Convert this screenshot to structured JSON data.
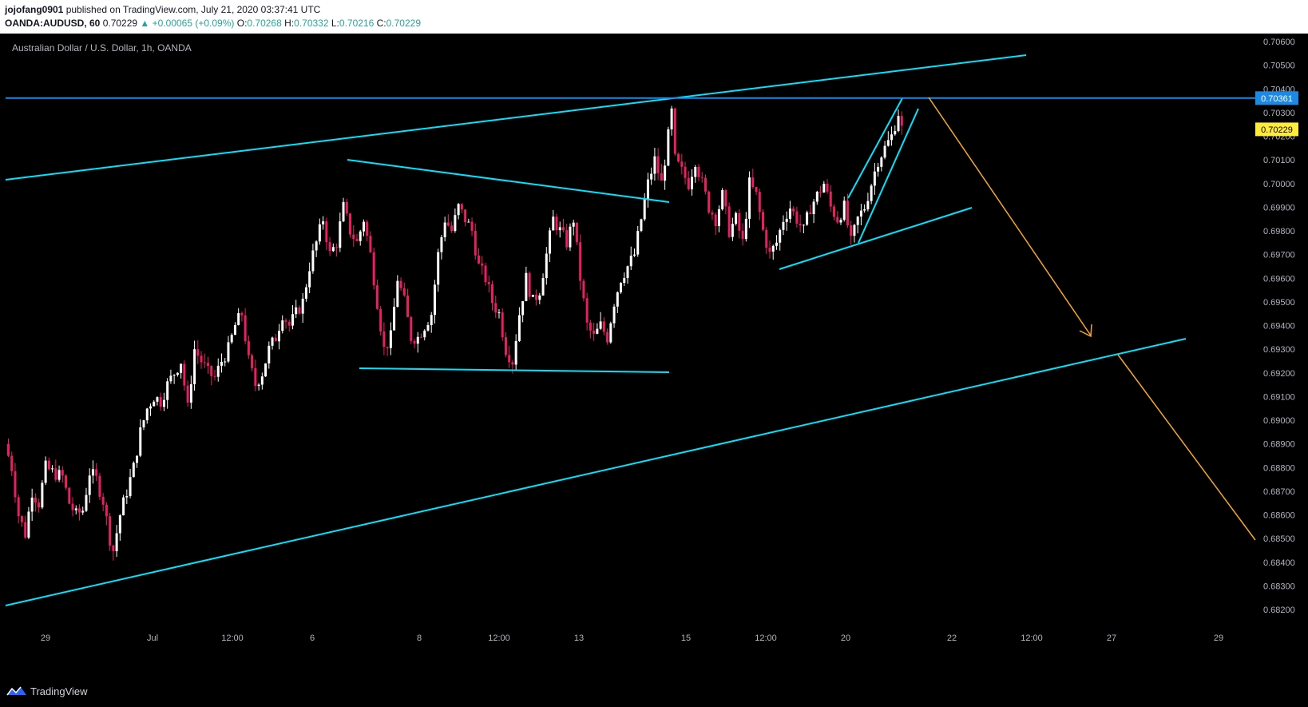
{
  "header": {
    "author": "jojofang0901",
    "published_text": "published on TradingView.com, July 21, 2020 03:37:41 UTC",
    "symbol": "OANDA:AUDUSD, 60",
    "last_price": "0.70229",
    "change": "▲ +0.00065 (+0.09%)",
    "o_label": "O:",
    "o_value": "0.70268",
    "h_label": "H:",
    "h_value": "0.70332",
    "l_label": "L:",
    "l_value": "0.70216",
    "c_label": "C:",
    "c_value": "0.70229"
  },
  "chart_title": "Australian Dollar / U.S. Dollar, 1h, OANDA",
  "footer": {
    "brand": "TradingView"
  },
  "colors": {
    "background": "#000000",
    "up_candle": "#ffffff",
    "down_candle": "#e91e63",
    "trendline": "#00e5ff",
    "hline": "#1e88e5",
    "projection": "#f9a825",
    "axis_text": "#b2b5be"
  },
  "price_labels": {
    "hline": "0.70361",
    "current": "0.70229"
  },
  "chart_data": {
    "type": "candlestick",
    "title": "Australian Dollar / U.S. Dollar, 1h, OANDA",
    "y_ticks": [
      "0.70600",
      "0.70500",
      "0.70400",
      "0.70300",
      "0.70200",
      "0.70100",
      "0.70000",
      "0.69900",
      "0.69800",
      "0.69700",
      "0.69600",
      "0.69500",
      "0.69400",
      "0.69300",
      "0.69200",
      "0.69100",
      "0.69000",
      "0.68900",
      "0.68800",
      "0.68700",
      "0.68600",
      "0.68500",
      "0.68400",
      "0.68300",
      "0.68200"
    ],
    "x_ticks": [
      "29",
      "Jul",
      "12:00",
      "6",
      "8",
      "12:00",
      "13",
      "15",
      "12:00",
      "20",
      "22",
      "12:00",
      "27",
      "29"
    ],
    "ylim": [
      0.6817,
      0.7065
    ],
    "hline_value": 0.70361,
    "current_value": 0.70229,
    "price_path": [
      [
        0,
        0.689
      ],
      [
        2,
        0.688
      ],
      [
        4,
        0.686
      ],
      [
        6,
        0.6852
      ],
      [
        8,
        0.687
      ],
      [
        10,
        0.6865
      ],
      [
        12,
        0.688
      ],
      [
        14,
        0.6878
      ],
      [
        17,
        0.6876
      ],
      [
        19,
        0.6865
      ],
      [
        21,
        0.686
      ],
      [
        23,
        0.6862
      ],
      [
        25,
        0.6878
      ],
      [
        27,
        0.6875
      ],
      [
        29,
        0.6866
      ],
      [
        31,
        0.685
      ],
      [
        32,
        0.6845
      ],
      [
        34,
        0.686
      ],
      [
        36,
        0.687
      ],
      [
        38,
        0.688
      ],
      [
        40,
        0.6895
      ],
      [
        42,
        0.6905
      ],
      [
        44,
        0.691
      ],
      [
        46,
        0.6908
      ],
      [
        48,
        0.6915
      ],
      [
        50,
        0.692
      ],
      [
        52,
        0.6925
      ],
      [
        54,
        0.6905
      ],
      [
        56,
        0.693
      ],
      [
        58,
        0.6925
      ],
      [
        60,
        0.692
      ],
      [
        62,
        0.6918
      ],
      [
        64,
        0.6925
      ],
      [
        66,
        0.693
      ],
      [
        68,
        0.694
      ],
      [
        70,
        0.6945
      ],
      [
        72,
        0.6925
      ],
      [
        74,
        0.6915
      ],
      [
        76,
        0.692
      ],
      [
        78,
        0.693
      ],
      [
        80,
        0.6935
      ],
      [
        82,
        0.6945
      ],
      [
        84,
        0.694
      ],
      [
        86,
        0.6945
      ],
      [
        88,
        0.695
      ],
      [
        90,
        0.6965
      ],
      [
        92,
        0.6975
      ],
      [
        94,
        0.6985
      ],
      [
        96,
        0.697
      ],
      [
        98,
        0.6975
      ],
      [
        100,
        0.699
      ],
      [
        102,
        0.698
      ],
      [
        104,
        0.6975
      ],
      [
        106,
        0.6985
      ],
      [
        108,
        0.697
      ],
      [
        110,
        0.695
      ],
      [
        112,
        0.693
      ],
      [
        114,
        0.6935
      ],
      [
        116,
        0.696
      ],
      [
        118,
        0.695
      ],
      [
        120,
        0.6935
      ],
      [
        122,
        0.6935
      ],
      [
        124,
        0.694
      ],
      [
        126,
        0.6945
      ],
      [
        128,
        0.697
      ],
      [
        130,
        0.6985
      ],
      [
        132,
        0.698
      ],
      [
        134,
        0.699
      ],
      [
        136,
        0.6985
      ],
      [
        138,
        0.698
      ],
      [
        140,
        0.6965
      ],
      [
        142,
        0.696
      ],
      [
        144,
        0.695
      ],
      [
        146,
        0.6945
      ],
      [
        148,
        0.693
      ],
      [
        150,
        0.6925
      ],
      [
        152,
        0.6945
      ],
      [
        154,
        0.696
      ],
      [
        156,
        0.695
      ],
      [
        158,
        0.6955
      ],
      [
        160,
        0.697
      ],
      [
        162,
        0.6985
      ],
      [
        164,
        0.698
      ],
      [
        166,
        0.6975
      ],
      [
        168,
        0.6985
      ],
      [
        170,
        0.696
      ],
      [
        172,
        0.694
      ],
      [
        174,
        0.6935
      ],
      [
        176,
        0.694
      ],
      [
        178,
        0.6935
      ],
      [
        180,
        0.695
      ],
      [
        182,
        0.696
      ],
      [
        184,
        0.6965
      ],
      [
        186,
        0.697
      ],
      [
        188,
        0.6985
      ],
      [
        190,
        0.7
      ],
      [
        192,
        0.701
      ],
      [
        194,
        0.7
      ],
      [
        196,
        0.702
      ],
      [
        197,
        0.703
      ],
      [
        198,
        0.701
      ],
      [
        200,
        0.7005
      ],
      [
        202,
        0.7
      ],
      [
        204,
        0.701
      ],
      [
        206,
        0.7
      ],
      [
        208,
        0.699
      ],
      [
        210,
        0.6985
      ],
      [
        212,
        0.6995
      ],
      [
        214,
        0.698
      ],
      [
        216,
        0.6985
      ],
      [
        218,
        0.6975
      ],
      [
        220,
        0.7
      ],
      [
        222,
        0.6995
      ],
      [
        224,
        0.698
      ],
      [
        226,
        0.697
      ],
      [
        228,
        0.6975
      ],
      [
        230,
        0.6985
      ],
      [
        232,
        0.699
      ],
      [
        234,
        0.6985
      ],
      [
        236,
        0.698
      ],
      [
        238,
        0.699
      ],
      [
        240,
        0.6995
      ],
      [
        242,
        0.7
      ],
      [
        244,
        0.699
      ],
      [
        246,
        0.6985
      ],
      [
        248,
        0.699
      ],
      [
        250,
        0.6975
      ],
      [
        252,
        0.6985
      ],
      [
        254,
        0.699
      ],
      [
        256,
        0.7
      ],
      [
        258,
        0.701
      ],
      [
        260,
        0.7015
      ],
      [
        262,
        0.702
      ],
      [
        264,
        0.703
      ],
      [
        265,
        0.7023
      ]
    ]
  }
}
